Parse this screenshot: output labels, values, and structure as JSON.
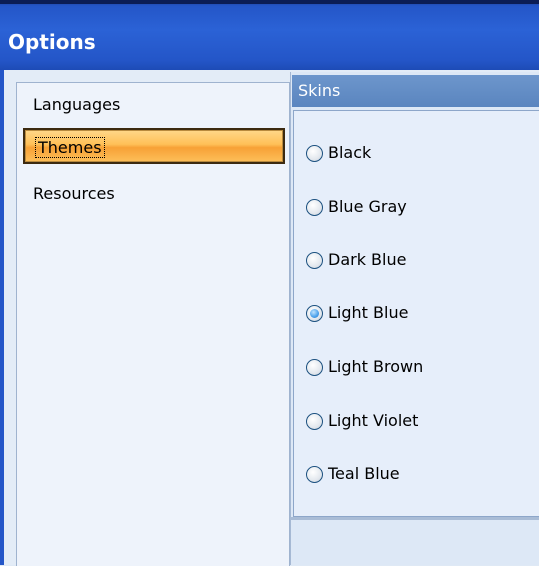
{
  "window": {
    "title": "Options"
  },
  "nav": {
    "items": [
      {
        "label": "Languages",
        "selected": false
      },
      {
        "label": "Themes",
        "selected": true
      },
      {
        "label": "Resources",
        "selected": false
      }
    ]
  },
  "skins": {
    "header": "Skins",
    "selected": "Light Blue",
    "options": [
      {
        "label": "Black"
      },
      {
        "label": "Blue Gray"
      },
      {
        "label": "Dark Blue"
      },
      {
        "label": "Light Blue"
      },
      {
        "label": "Light Brown"
      },
      {
        "label": "Light Violet"
      },
      {
        "label": "Teal Blue"
      }
    ]
  },
  "colors": {
    "titlebar": "#2456c8",
    "selected_nav": "#f7a136",
    "skins_header": "#5a85bf"
  }
}
